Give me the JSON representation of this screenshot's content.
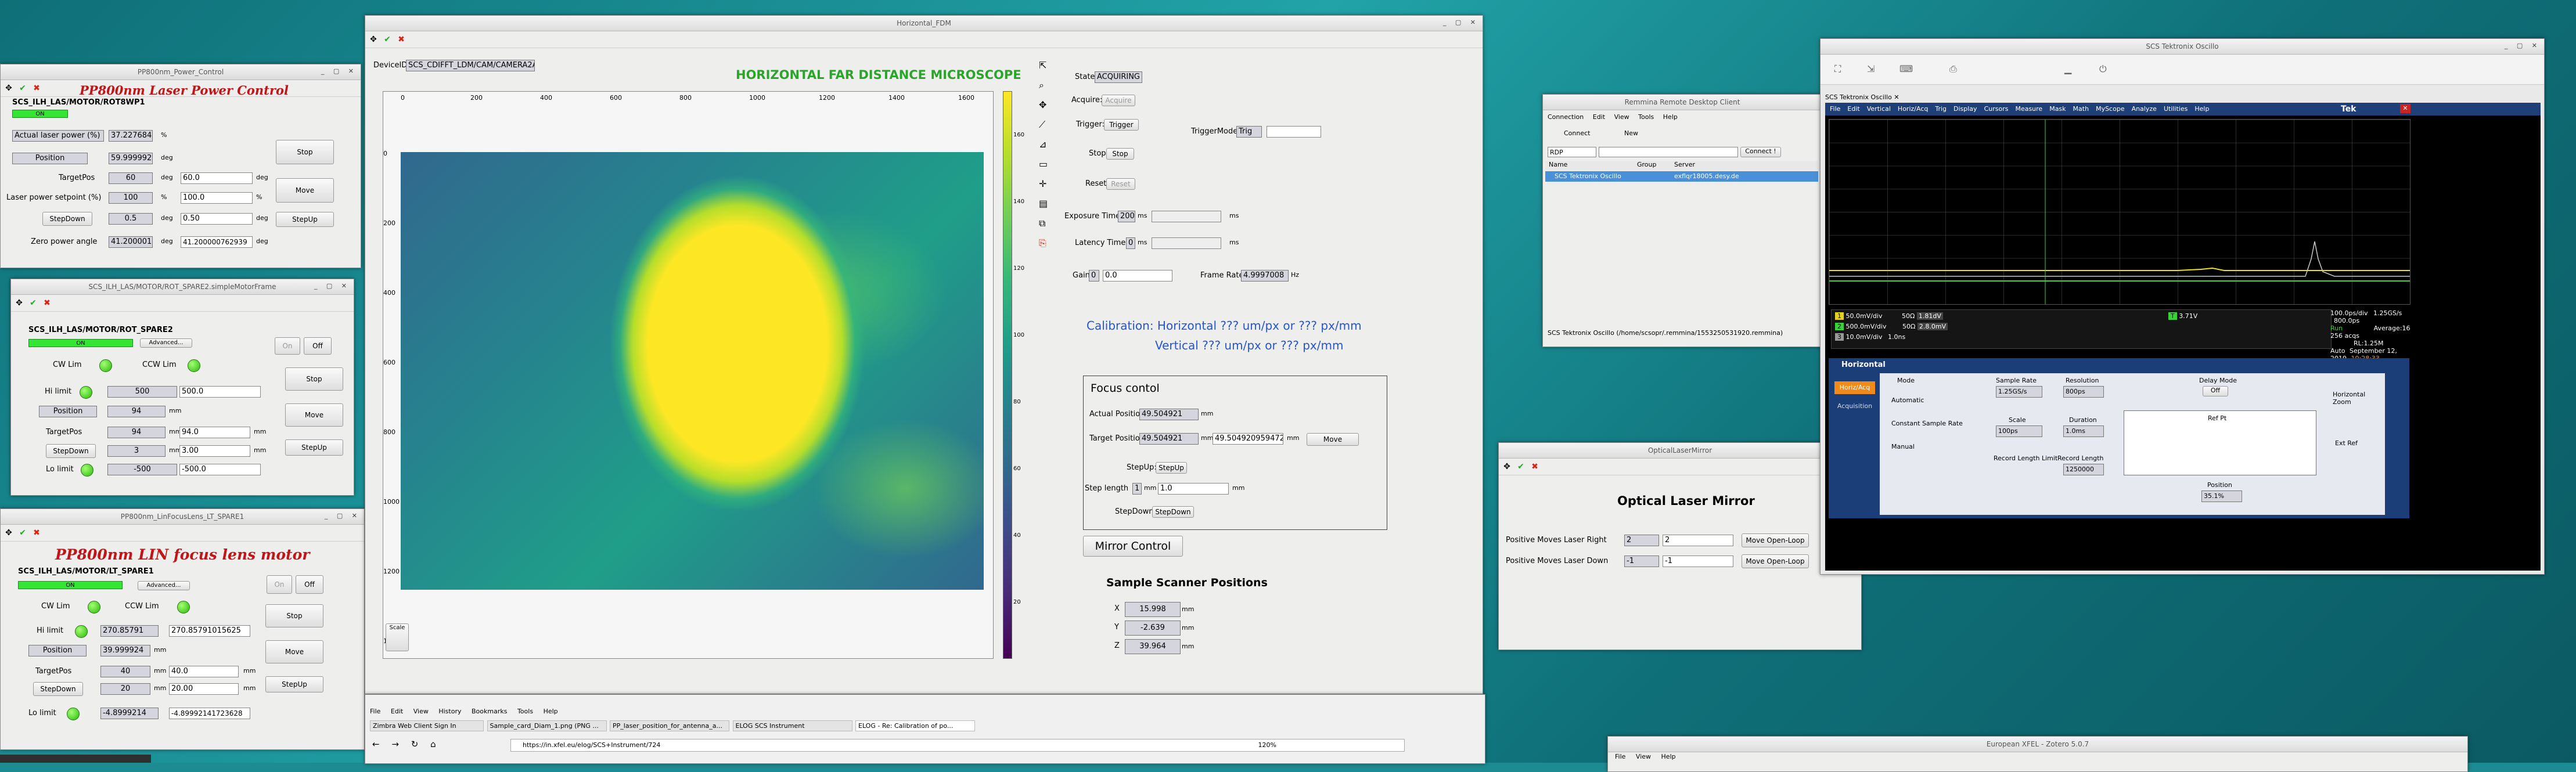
{
  "desktop": {
    "bg": "#1d8c92"
  },
  "laser": {
    "title": "PP800nm_Power_Control",
    "heading": "PP800nm Laser Power Control",
    "device": "SCS_ILH_LAS/MOTOR/ROT8WP1",
    "on": "ON",
    "actual_label": "Actual laser power (%)",
    "actual_value": "37.227684",
    "actual_unit": "%",
    "position_label": "Position",
    "position_value": "59.999992",
    "position_unit": "deg",
    "target_label": "TargetPos",
    "target_value": "60",
    "target_unit": "deg",
    "target_input": "60.0",
    "setpoint_label": "Laser power setpoint (%)",
    "setpoint_value": "100",
    "setpoint_unit": "%",
    "setpoint_input": "100.0",
    "stepdown_label": "StepDown",
    "step_value": "0.5",
    "step_unit": "deg",
    "step_input": "0.50",
    "zero_label": "Zero power angle",
    "zero_value": "41.200001",
    "zero_unit": "deg",
    "zero_input": "41.200000762939",
    "stop": "Stop",
    "move": "Move",
    "stepup": "StepUp"
  },
  "rot": {
    "title": "SCS_ILH_LAS/MOTOR/ROT_SPARE2.simpleMotorFrame",
    "device": "SCS_ILH_LAS/MOTOR/ROT_SPARE2",
    "on": "ON",
    "advanced": "Advanced...",
    "on_btn": "On",
    "off_btn": "Off",
    "cw": "CW Lim",
    "ccw": "CCW Lim",
    "hi_label": "Hi limit",
    "hi_value": "500",
    "hi_input": "500.0",
    "pos_label": "Position",
    "pos_value": "94",
    "pos_unit": "mm",
    "target_label": "TargetPos",
    "target_value": "94",
    "target_input": "94.0",
    "target_unit": "mm",
    "stepdown": "StepDown",
    "step_value": "3",
    "step_unit": "mm",
    "step_input": "3.00",
    "lo_label": "Lo limit",
    "lo_value": "-500",
    "lo_input": "-500.0",
    "stop": "Stop",
    "move": "Move",
    "stepup": "StepUp"
  },
  "lin": {
    "title": "PP800nm_LinFocusLens_LT_SPARE1",
    "heading": "PP800nm LIN focus lens motor",
    "device": "SCS_ILH_LAS/MOTOR/LT_SPARE1",
    "on": "ON",
    "advanced": "Advanced...",
    "on_btn": "On",
    "off_btn": "Off",
    "cw": "CW Lim",
    "ccw": "CCW Lim",
    "hi_label": "Hi limit",
    "hi_value": "270.85791",
    "hi_input": "270.85791015625",
    "pos_label": "Position",
    "pos_value": "39.999924",
    "pos_unit": "mm",
    "target_label": "TargetPos",
    "target_value": "40",
    "target_input": "40.0",
    "target_unit": "mm",
    "stepdown": "StepDown",
    "step_value": "20",
    "step_unit": "mm",
    "step_input": "20.00",
    "lo_label": "Lo limit",
    "lo_value": "-4.8999214",
    "lo_input": "-4.89992141723628",
    "stop": "Stop",
    "move": "Move",
    "stepup": "StepUp"
  },
  "fdm": {
    "title": "Horizontal_FDM",
    "device_label": "DeviceID",
    "device_value": "SCS_CDIFFT_LDM/CAM/CAMERA2A",
    "heading": "HORIZONTAL FAR DISTANCE MICROSCOPE",
    "x_ticks": [
      "0",
      "200",
      "400",
      "600",
      "800",
      "1000",
      "1200",
      "1400",
      "1600"
    ],
    "y_ticks": [
      "0",
      "200",
      "400",
      "600",
      "800",
      "1000",
      "1200",
      "1400"
    ],
    "cb_ticks": [
      "160",
      "140",
      "120",
      "100",
      "80",
      "60",
      "40",
      "20"
    ],
    "scale_label": "Scale",
    "state_label": "State",
    "state_value": "ACQUIRING",
    "acquire_label": "Acquire:",
    "acquire_btn": "Acquire",
    "trigger_label": "Trigger:",
    "trigger_btn": "Trigger",
    "trigmode_label": "TriggerMode",
    "trigmode_value": "Trig",
    "stop_label": "Stop:",
    "stop_btn": "Stop",
    "reset_label": "Reset:",
    "reset_btn": "Reset",
    "exp_label": "Exposure Time",
    "exp_value": "200",
    "exp_unit": "ms",
    "lat_label": "Latency Time",
    "lat_value": "0",
    "lat_unit": "ms",
    "gain_label": "Gain",
    "gain_value": "0",
    "gain_input": "0.0",
    "frame_label": "Frame Rate",
    "frame_value": "4.9997008",
    "frame_unit": "Hz",
    "calib1": "Calibration:  Horizontal ??? um/px or ??? px/mm",
    "calib2": "Vertical ??? um/px or ??? px/mm",
    "focus_title": "Focus contol",
    "actual_label": "Actual Position",
    "actual_value": "49.504921",
    "actual_unit": "mm",
    "target_label": "Target Position",
    "target_value": "49.504921",
    "target_unit": "mm",
    "target_input": "49.5049209594726",
    "target_unit2": "mm",
    "move_btn": "Move",
    "stepup_label": "StepUp:",
    "stepup_btn": "StepUp",
    "steplen_label": "Step length",
    "steplen_value": "1",
    "steplen_unit": "mm",
    "steplen_input": "1.0",
    "steplen_unit2": "mm",
    "stepdown_label": "StepDown:",
    "stepdown_btn": "StepDown",
    "mirror_btn": "Mirror Control",
    "sample_title": "Sample Scanner Positions",
    "sx": "X",
    "sx_value": "15.998",
    "sx_unit": "mm",
    "sy": "Y",
    "sy_value": "-2.639",
    "sy_unit": "mm",
    "sz": "Z",
    "sz_value": "39.964",
    "sz_unit": "mm"
  },
  "browser": {
    "menu": [
      "File",
      "Edit",
      "View",
      "History",
      "Bookmarks",
      "Tools",
      "Help"
    ],
    "tabs": [
      "Zimbra Web Client Sign In",
      "Sample_card_Diam_1.png (PNG ...",
      "PP_laser_position_for_antenna_a...",
      "ELOG SCS Instrument",
      "ELOG - Re: Calibration of po..."
    ],
    "url": "https://in.xfel.eu/elog/SCS+Instrument/724",
    "zoom": "120%"
  },
  "remmina": {
    "title": "Remmina Remote Desktop Client",
    "menu": [
      "Connection",
      "Edit",
      "View",
      "Tools",
      "Help"
    ],
    "connect": "Connect",
    "new": "New",
    "proto": "RDP",
    "connect2": "Connect !",
    "cols": [
      "Name",
      "Group",
      "Server"
    ],
    "row_name": "SCS Tektronix Oscillo",
    "row_group": "",
    "row_server": "exflqr18005.desy.de",
    "status": "SCS Tektronix Oscillo (/home/scsopr/.remmina/1553250531920.remmina)"
  },
  "mirror": {
    "title": "OpticalLaserMirror",
    "heading": "Optical Laser Mirror",
    "right_label": "Positive Moves Laser Right",
    "right_value": "2",
    "right_input": "2",
    "right_btn": "Move Open-Loop",
    "down_label": "Positive Moves Laser Down",
    "down_value": "-1",
    "down_input": "-1",
    "down_btn": "Move Open-Loop"
  },
  "tek": {
    "title": "SCS Tektronix Oscillo",
    "tab": "SCS Tektronix Oscillo",
    "menu": [
      "File",
      "Edit",
      "Vertical",
      "Horiz/Acq",
      "Trig",
      "Display",
      "Cursors",
      "Measure",
      "Mask",
      "Math",
      "MyScope",
      "Analyze",
      "Utilities",
      "Help"
    ],
    "brand": "Tek",
    "ch1": "50.0mV/div",
    "ch1b": "50Ω",
    "ch1c": "1.81dV",
    "ch2": "500.0mV/div",
    "ch2b": "50Ω",
    "ch2c": "2.8.0mV",
    "ch3": "10.0mV/div",
    "ch3c": "1.0ns",
    "trig": "3.71V",
    "rt1": "100.0ps/div",
    "rt1b": "1.25GS/s",
    "rt1c": "800.0ps",
    "rt2": "Run",
    "rt2b": "Average:16",
    "rt3": "256 acqs",
    "rt3b": "RL:1.25M",
    "rt4": "Auto",
    "rt4b": "September 12, 2019",
    "rt4c": "10:28:33",
    "horiz_title": "Horizontal",
    "side1": "Horiz/Acq",
    "side2": "Acquisition",
    "mode": "Mode",
    "m_auto": "Automatic",
    "m_const": "Constant Sample Rate",
    "m_manual": "Manual",
    "srate": "Sample Rate",
    "srate_v": "1.25GS/s",
    "res": "Resolution",
    "res_v": "800ps",
    "scale": "Scale",
    "scale_v": "100ps",
    "dur": "Duration",
    "dur_v": "1.0ms",
    "reclen": "Record Length\nLimit",
    "rec": "Record Length",
    "rec_v": "1250000",
    "delay": "Delay Mode",
    "delay_v": "Off",
    "pos": "Position",
    "pos_v": "35.1%",
    "ref": "Ref Pt",
    "hzoom": "Horizontal Zoom",
    "ext": "Ext Ref"
  },
  "zotero": {
    "title": "European XFEL - Zotero 5.0.7",
    "menu": [
      "File",
      "View",
      "Help"
    ]
  }
}
